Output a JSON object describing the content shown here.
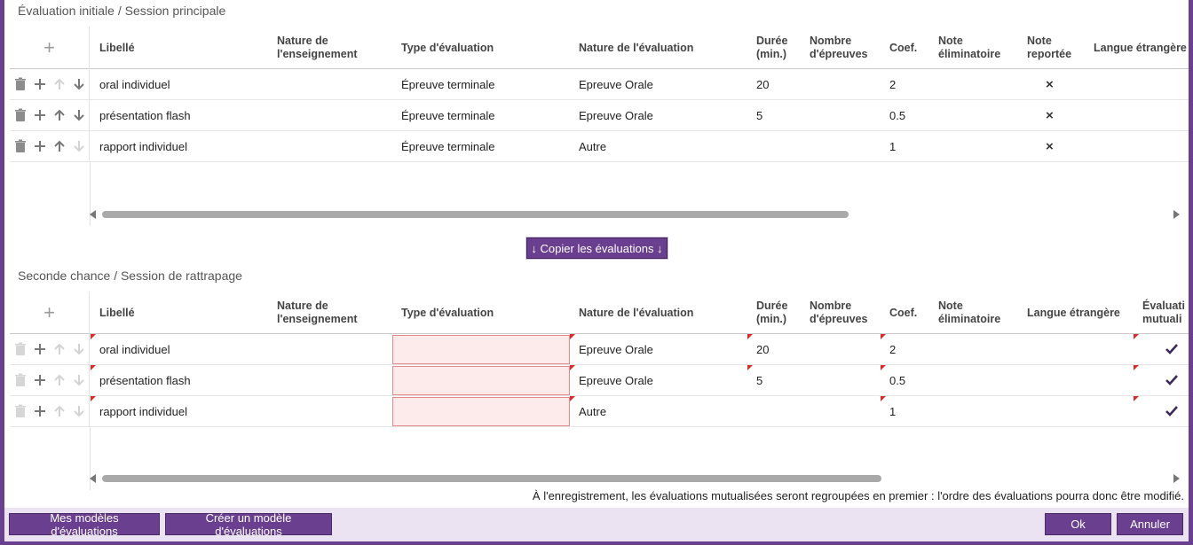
{
  "section1": {
    "title": "Évaluation initiale / Session principale",
    "headers": {
      "libelle": "Libellé",
      "nature_enseignement_1": "Nature de",
      "nature_enseignement_2": "l'enseignement",
      "type_evaluation": "Type d'évaluation",
      "nature_evaluation": "Nature de l'évaluation",
      "duree_1": "Durée",
      "duree_2": "(min.)",
      "nombre_1": "Nombre",
      "nombre_2": "d'épreuves",
      "coef": "Coef.",
      "note_elim_1": "Note",
      "note_elim_2": "éliminatoire",
      "note_rep_1": "Note",
      "note_rep_2": "reportée",
      "langue": "Langue étrangère"
    },
    "rows": [
      {
        "libelle": "oral individuel",
        "type": "Épreuve terminale",
        "nature": "Epreuve Orale",
        "duree": "20",
        "coef": "2",
        "reportee": "×"
      },
      {
        "libelle": "présentation flash",
        "type": "Épreuve terminale",
        "nature": "Epreuve Orale",
        "duree": "5",
        "coef": "0.5",
        "reportee": "×"
      },
      {
        "libelle": "rapport individuel",
        "type": "Épreuve terminale",
        "nature": "Autre",
        "duree": "",
        "coef": "1",
        "reportee": "×"
      }
    ]
  },
  "copy_button": "↓ Copier les évaluations ↓",
  "section2": {
    "title": "Seconde chance / Session de rattrapage",
    "headers": {
      "libelle": "Libellé",
      "nature_enseignement_1": "Nature de",
      "nature_enseignement_2": "l'enseignement",
      "type_evaluation": "Type d'évaluation",
      "nature_evaluation": "Nature de l'évaluation",
      "duree_1": "Durée",
      "duree_2": "(min.)",
      "nombre_1": "Nombre",
      "nombre_2": "d'épreuves",
      "coef": "Coef.",
      "note_elim_1": "Note",
      "note_elim_2": "éliminatoire",
      "langue": "Langue étrangère",
      "mutual_1": "Évaluati",
      "mutual_2": "mutuali"
    },
    "rows": [
      {
        "libelle": "oral individuel",
        "type": "",
        "nature": "Epreuve Orale",
        "duree": "20",
        "coef": "2"
      },
      {
        "libelle": "présentation flash",
        "type": "",
        "nature": "Epreuve Orale",
        "duree": "5",
        "coef": "0.5"
      },
      {
        "libelle": "rapport individuel",
        "type": "",
        "nature": "Autre",
        "duree": "",
        "coef": "1"
      }
    ]
  },
  "note": "À l'enregistrement, les évaluations mutualisées seront regroupées en premier : l'ordre des évaluations pourra donc être modifié.",
  "footer": {
    "models_button": "Mes modèles d'évaluations",
    "create_model_button": "Créer un modèle d'évaluations",
    "ok_button": "Ok",
    "cancel_button": "Annuler"
  },
  "colors": {
    "accent": "#6a3f8f",
    "error_bg": "#fdeaea",
    "error_flag": "#d92b2b",
    "footer_bg": "#ebe3f2"
  },
  "icons": [
    "trash-icon",
    "plus-icon",
    "arrow-up-icon",
    "arrow-down-icon",
    "close-icon",
    "checkmark-icon"
  ]
}
